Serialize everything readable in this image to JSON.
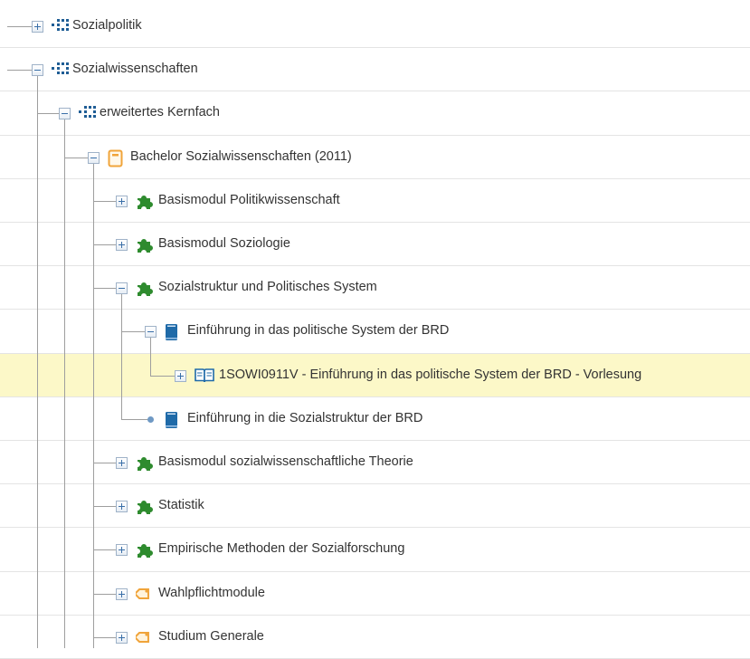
{
  "tree": {
    "nodes": [
      {
        "label": "Sozialpolitik",
        "icon": "org-unit-icon",
        "state": "collapsed",
        "level": 0
      },
      {
        "label": "Sozialwissenschaften",
        "icon": "org-unit-icon",
        "state": "expanded",
        "level": 0
      },
      {
        "label": "erweitertes Kernfach",
        "icon": "org-unit-icon",
        "state": "expanded",
        "level": 1
      },
      {
        "label": "Bachelor Sozialwissenschaften (2011)",
        "icon": "study-program-icon",
        "state": "expanded",
        "level": 2
      },
      {
        "label": "Basismodul Politikwissenschaft",
        "icon": "module-puzzle-icon",
        "state": "collapsed",
        "level": 3
      },
      {
        "label": "Basismodul Soziologie",
        "icon": "module-puzzle-icon",
        "state": "collapsed",
        "level": 3
      },
      {
        "label": "Sozialstruktur und Politisches System",
        "icon": "module-puzzle-icon",
        "state": "expanded",
        "level": 3
      },
      {
        "label": "Einführung in das politische System der BRD",
        "icon": "course-book-icon",
        "state": "expanded",
        "level": 4
      },
      {
        "label": "1SOWI0911V - Einführung in das politische System der BRD - Vorlesung",
        "icon": "open-book-icon",
        "state": "collapsed",
        "level": 5,
        "highlighted": true
      },
      {
        "label": "Einführung in die Sozialstruktur der BRD",
        "icon": "course-book-icon",
        "state": "leaf",
        "level": 4
      },
      {
        "label": "Basismodul sozialwissenschaftliche Theorie",
        "icon": "module-puzzle-icon",
        "state": "collapsed",
        "level": 3
      },
      {
        "label": "Statistik",
        "icon": "module-puzzle-icon",
        "state": "collapsed",
        "level": 3
      },
      {
        "label": "Empirische Methoden der Sozialforschung",
        "icon": "module-puzzle-icon",
        "state": "collapsed",
        "level": 3
      },
      {
        "label": "Wahlpflichtmodule",
        "icon": "tag-icon",
        "state": "collapsed",
        "level": 3
      },
      {
        "label": "Studium Generale",
        "icon": "tag-icon",
        "state": "collapsed",
        "level": 3
      }
    ]
  },
  "colors": {
    "highlight_row": "#fcf8c8",
    "module_icon": "#2e8b2e",
    "org_icon": "#1f5d95",
    "book_icon": "#1f6aa8",
    "tag_icon": "#f0a43a",
    "program_icon": "#f0a43a"
  }
}
